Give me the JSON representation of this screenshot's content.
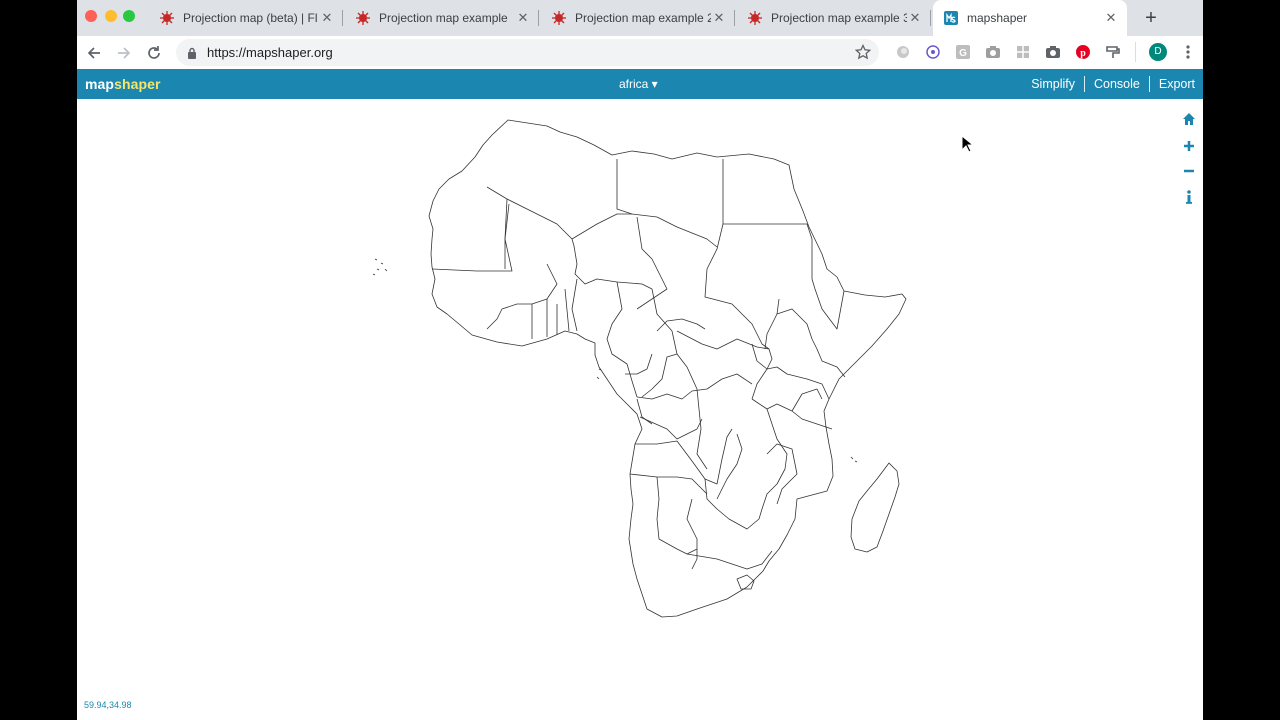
{
  "browser": {
    "tabs": [
      {
        "title": "Projection map (beta) | Fl",
        "favicon": "red-burst-icon",
        "active": false
      },
      {
        "title": "Projection map example",
        "favicon": "red-burst-icon",
        "active": false
      },
      {
        "title": "Projection map example 2",
        "favicon": "red-burst-icon",
        "active": false
      },
      {
        "title": "Projection map example 3",
        "favicon": "red-burst-icon",
        "active": false
      },
      {
        "title": "mapshaper",
        "favicon": "mapshaper-icon",
        "active": true
      }
    ],
    "new_tab_label": "+",
    "url": "https://mapshaper.org",
    "profile_initial": "D",
    "extensions": [
      "extension-circle-icon",
      "extension-target-icon",
      "extension-g-icon",
      "extension-camera-icon",
      "extension-puzzle-icon",
      "extension-camera2-icon",
      "pinterest-icon",
      "extension-paint-icon"
    ]
  },
  "app": {
    "logo_main": "map",
    "logo_accent": "shaper",
    "layer_name": "africa ▾",
    "nav": {
      "simplify": "Simplify",
      "console": "Console",
      "export": "Export"
    },
    "coords_readout": "59.94,34.98"
  },
  "colors": {
    "brand_bar": "#1b87b1",
    "logo_accent": "#f5e66a",
    "map_stroke": "#333333"
  }
}
